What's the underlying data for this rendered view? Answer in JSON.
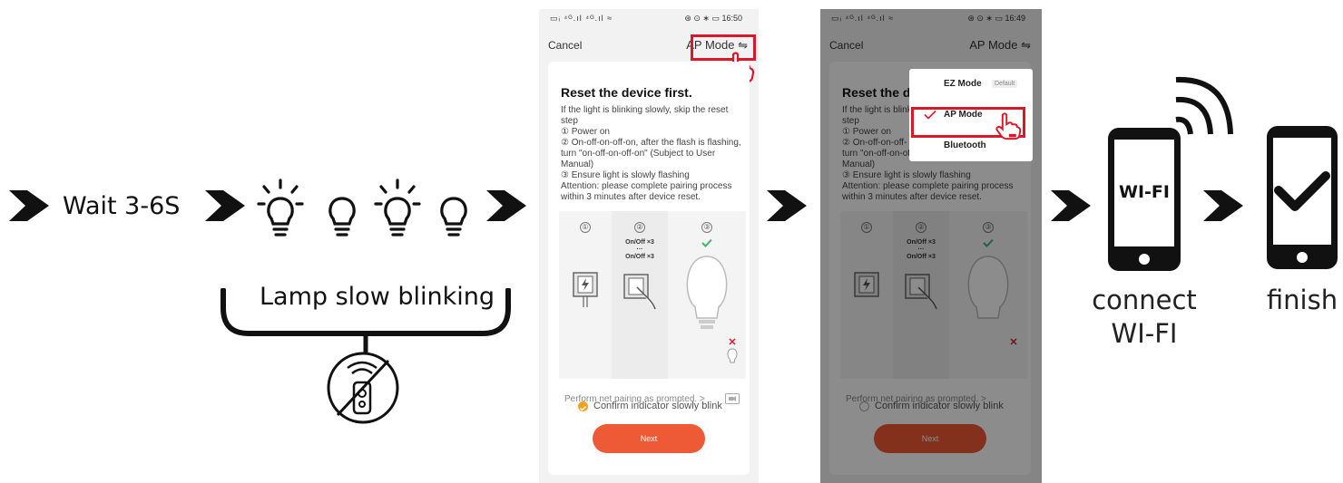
{
  "colors": {
    "accent_red": "#d9182a",
    "next_button": "#ee5a35",
    "confirm_check": "#f2a021",
    "check_green": "#40b46a"
  },
  "steps": {
    "wait_label": "Wait 3-6S",
    "lamp_label": "Lamp slow blinking",
    "connect_label_1": "connect",
    "connect_label_2": "WI-FI",
    "wifi_phone_label": "WI-FI",
    "finish_label": "finish"
  },
  "icons": {
    "arrow": "right-arrow-icon",
    "bulb_on": "lightbulb-on-icon",
    "bulb_off": "lightbulb-off-icon",
    "remote_off": "remote-disabled-icon",
    "wifi": "wifi-signal-icon",
    "check": "checkmark-icon",
    "hand": "pointing-hand-icon"
  },
  "screen1": {
    "status_left": "▭ᵢ ⁴ᴳ.ıl ⁴ᴳ.ıl ≈",
    "status_right": "⊛ ⊙ ∗ ▭ 16:50",
    "cancel": "Cancel",
    "mode": "AP Mode ⇋",
    "title": "Reset the device first.",
    "steps_text": [
      "If the light is blinking slowly, skip the reset step",
      "① Power on",
      "② On-off-on-off-on, after the flash is flashing, turn \"on-off-on-off-on\" (Subject to User Manual)",
      "③ Ensure light is slowly flashing",
      "Attention: please complete pairing process within 3 minutes after device reset."
    ],
    "illus_num1": "①",
    "illus_num2": "②",
    "illus_num3": "③",
    "onoff_top": "On/Off ×3",
    "onoff_dots": "···",
    "onoff_bottom": "On/Off ×3",
    "prompt": "Perform net pairing as prompted.  >",
    "confirm": "Confirm indicator slowly blink",
    "next": "Next"
  },
  "screen2": {
    "status_left": "▭ᵢ ⁴ᴳ.ıl ⁴ᴳ.ıl ≈",
    "status_right": "⊛ ⊙ ∗ ▭ 16:49",
    "cancel": "Cancel",
    "mode": "AP Mode ⇋",
    "title": "Reset the de",
    "steps_text": [
      "If the light is blink",
      "step",
      "① Power on",
      "② On-off-on-off-",
      "turn \"on-off-on-of",
      "Manual)",
      "③ Ensure light is slowly flashing",
      "Attention: please complete pairing process within 3 minutes after device reset."
    ],
    "illus_num1": "①",
    "illus_num2": "②",
    "illus_num3": "③",
    "onoff_top": "On/Off ×3",
    "onoff_dots": "···",
    "onoff_bottom": "On/Off ×3",
    "prompt": "Perform net pairing as prompted.  >",
    "confirm": "Confirm indicator slowly blink",
    "next": "Next",
    "menu": {
      "ez_mode": "EZ Mode",
      "default_badge": "Default",
      "ap_mode": "AP Mode",
      "bluetooth": "Bluetooth"
    }
  }
}
